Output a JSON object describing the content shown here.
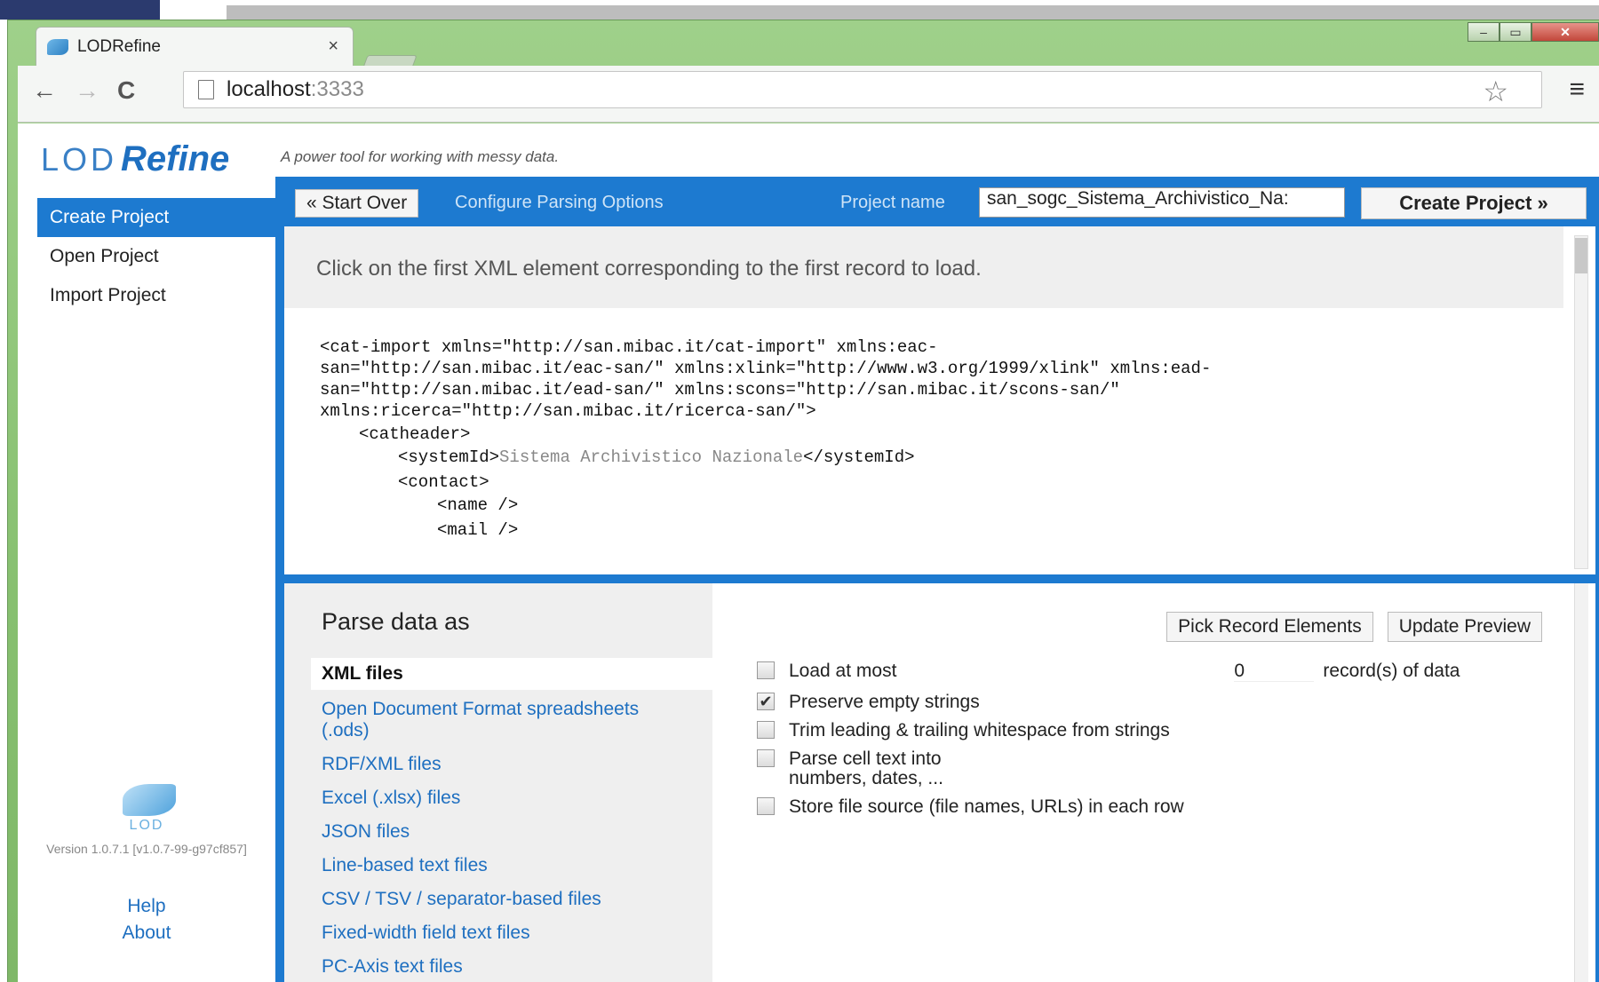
{
  "browser": {
    "tab_title": "LODRefine",
    "tab_close": "×",
    "url_host": "localhost",
    "url_port": ":3333",
    "window_min": "–",
    "window_max": "▭",
    "window_close": "✕"
  },
  "app": {
    "logo_lod": "LOD",
    "logo_refine": "Refine",
    "tagline": "A power tool for working with messy data."
  },
  "nav": {
    "items": [
      {
        "label": "Create Project"
      },
      {
        "label": "Open Project"
      },
      {
        "label": "Import Project"
      }
    ]
  },
  "footer": {
    "logo_text": "LOD",
    "version": "Version 1.0.7.1 [v1.0.7-99-g97cf857]",
    "help": "Help",
    "about": "About"
  },
  "controls": {
    "start_over": "« Start Over",
    "configure": "Configure Parsing Options",
    "project_name_label": "Project name",
    "project_name_value": "san_sogc_Sistema_Archivistico_Na:",
    "create_project": "Create Project »"
  },
  "preview": {
    "instruction": "Click on the first XML element corresponding to the first record to load.",
    "xml_lines": {
      "l1": "<cat-import xmlns=\"http://san.mibac.it/cat-import\" xmlns:eac-",
      "l2": "san=\"http://san.mibac.it/eac-san/\" xmlns:xlink=\"http://www.w3.org/1999/xlink\" xmlns:ead-",
      "l3": "san=\"http://san.mibac.it/ead-san/\" xmlns:scons=\"http://san.mibac.it/scons-san/\"",
      "l4": "xmlns:ricerca=\"http://san.mibac.it/ricerca-san/\">",
      "l5": "<catheader>",
      "l6_open": "<systemId>",
      "l6_value": "Sistema Archivistico Nazionale",
      "l6_close": "</systemId>",
      "l7": "<contact>",
      "l8": "<name />",
      "l9": "<mail />"
    }
  },
  "parse": {
    "heading": "Parse data as",
    "formats": [
      {
        "label": "XML files"
      },
      {
        "label": "Open Document Format spreadsheets (.ods)"
      },
      {
        "label": "RDF/XML files"
      },
      {
        "label": "Excel (.xlsx) files"
      },
      {
        "label": "JSON files"
      },
      {
        "label": "Line-based text files"
      },
      {
        "label": "CSV / TSV / separator-based files"
      },
      {
        "label": "Fixed-width field text files"
      },
      {
        "label": "PC-Axis text files"
      }
    ],
    "pick_record": "Pick Record Elements",
    "update_preview": "Update Preview",
    "options": {
      "load_at_most": "Load at most",
      "load_value": "0",
      "load_suffix": "record(s) of data",
      "preserve_empty": "Preserve empty strings",
      "trim": "Trim leading & trailing whitespace from strings",
      "parse_cell_1": "Parse cell text into",
      "parse_cell_2": "numbers, dates, ...",
      "store_source": "Store file source (file names, URLs) in each row",
      "checked_mark": "✔"
    }
  }
}
